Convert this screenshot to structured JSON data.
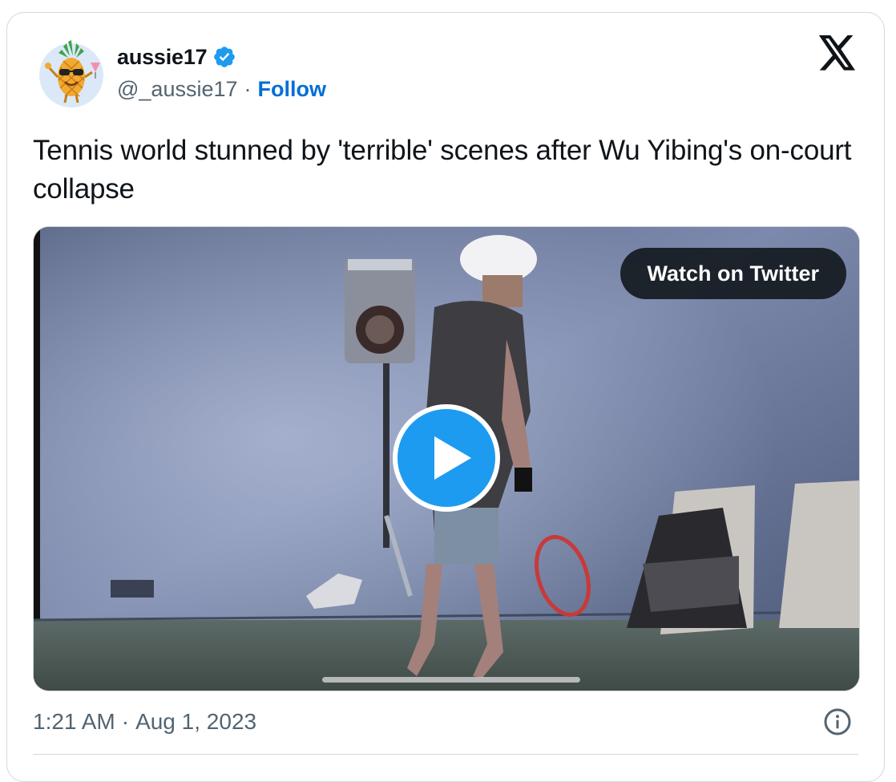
{
  "tweet": {
    "author": {
      "name": "aussie17",
      "handle": "@_aussie17",
      "separator": "·",
      "follow_label": "Follow",
      "avatar_icon": "pineapple-avatar-icon",
      "verified_icon": "verified-badge-icon"
    },
    "brand_icon": "x-logo-icon",
    "text": "Tennis world stunned by 'terrible' scenes after Wu Yibing's on-court collapse",
    "media": {
      "watch_label": "Watch on Twitter",
      "play_icon": "play-icon"
    },
    "time": "1:21 AM",
    "time_separator": "·",
    "date": "Aug 1, 2023",
    "info_icon": "info-icon"
  },
  "colors": {
    "text_primary": "#0f1419",
    "text_secondary": "#536471",
    "follow_link": "#006fd6",
    "verified_badge": "#1d9bf0",
    "play_button": "#1d9bf0",
    "border": "#cfd9de"
  }
}
